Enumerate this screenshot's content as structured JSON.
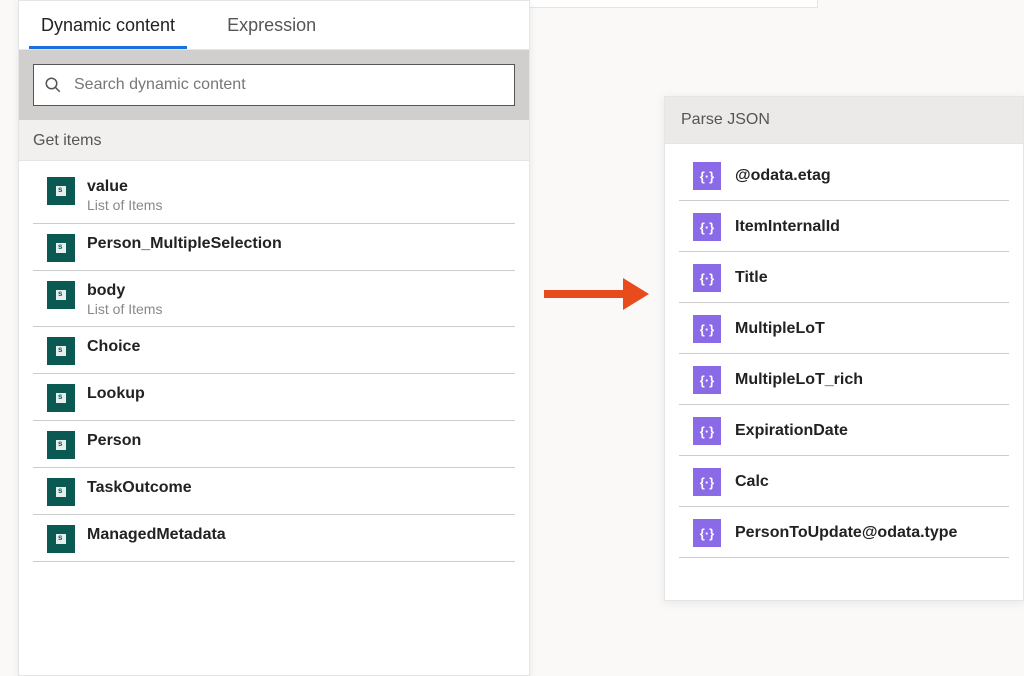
{
  "tabs": {
    "dynamic": "Dynamic content",
    "expression": "Expression"
  },
  "search": {
    "placeholder": "Search dynamic content"
  },
  "group": {
    "header": "Get items"
  },
  "items": [
    {
      "title": "value",
      "sub": "List of Items"
    },
    {
      "title": "Person_MultipleSelection",
      "sub": ""
    },
    {
      "title": "body",
      "sub": "List of Items"
    },
    {
      "title": "Choice",
      "sub": ""
    },
    {
      "title": "Lookup",
      "sub": ""
    },
    {
      "title": "Person",
      "sub": ""
    },
    {
      "title": "TaskOutcome",
      "sub": ""
    },
    {
      "title": "ManagedMetadata",
      "sub": ""
    }
  ],
  "right": {
    "header": "Parse JSON",
    "items": [
      "@odata.etag",
      "ItemInternalId",
      "Title",
      "MultipleLoT",
      "MultipleLoT_rich",
      "ExpirationDate",
      "Calc",
      "PersonToUpdate@odata.type"
    ],
    "iconGlyph": "{·}"
  }
}
